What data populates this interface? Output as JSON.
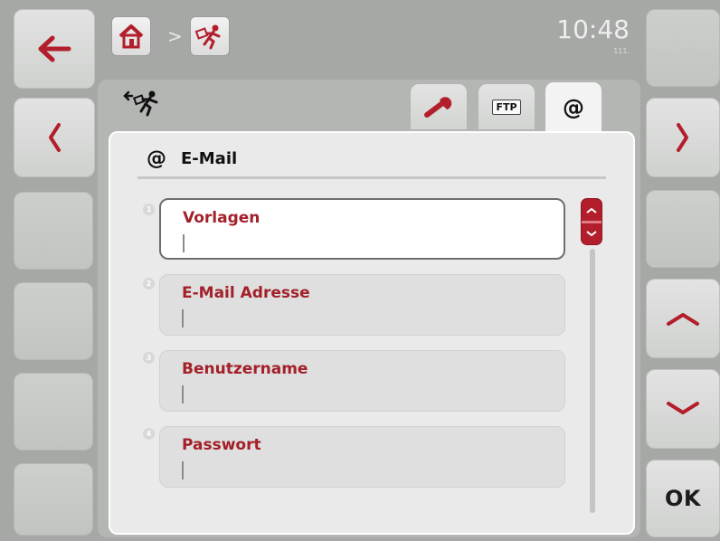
{
  "left_buttons": {
    "back_icon": "arrow-left-icon",
    "prev_icon": "chevron-left-icon"
  },
  "right_buttons": {
    "next_icon": "chevron-right-icon",
    "up_icon": "chevron-up-icon",
    "down_icon": "chevron-down-icon",
    "ok_label": "OK"
  },
  "header": {
    "breadcrumb_separator": ">",
    "home_icon": "home-icon",
    "app_icon": "export-runner-icon",
    "clock": "10:48",
    "clock_sub": "111."
  },
  "tabs": [
    {
      "icon": "wrench-icon",
      "label": ""
    },
    {
      "icon": "ftp-icon",
      "label": "FTP"
    },
    {
      "icon": "at-icon",
      "label": "@"
    }
  ],
  "panel": {
    "title_icon": "@",
    "title": "E-Mail"
  },
  "fields": [
    {
      "num": "1",
      "label": "Vorlagen",
      "value": ""
    },
    {
      "num": "2",
      "label": "E-Mail Adresse",
      "value": ""
    },
    {
      "num": "3",
      "label": "Benutzername",
      "value": ""
    },
    {
      "num": "4",
      "label": "Passwort",
      "value": ""
    }
  ],
  "colors": {
    "accent": "#a3202a",
    "background": "#a6a8a6",
    "panel": "#e9eae9"
  }
}
